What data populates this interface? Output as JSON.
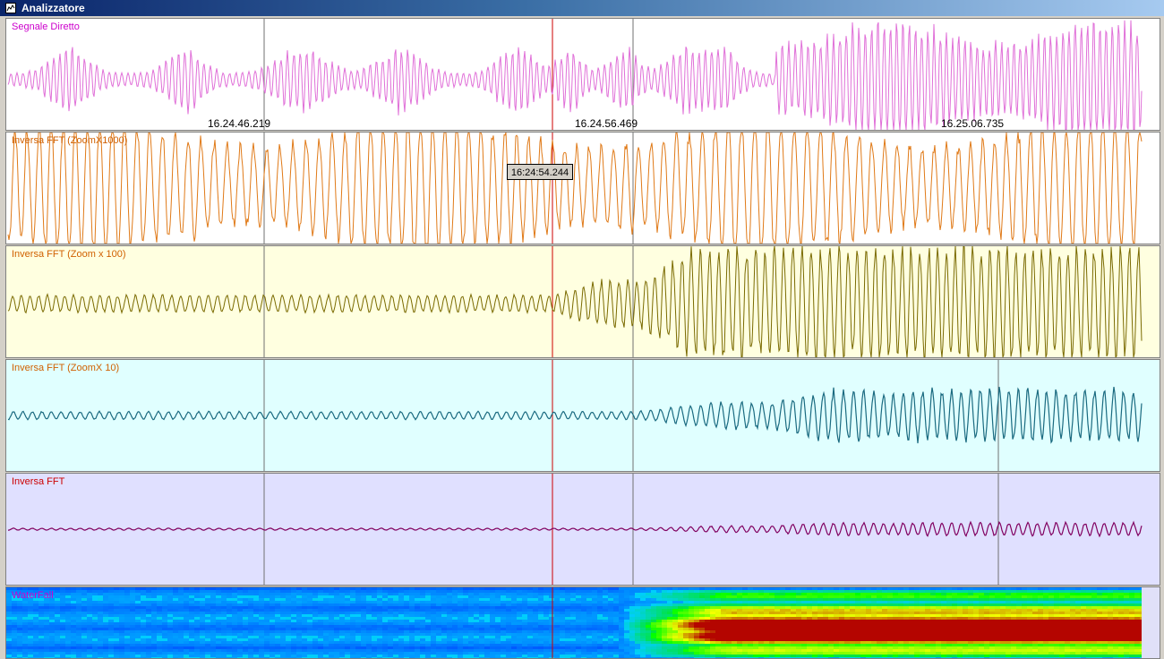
{
  "window": {
    "title": "Analizzatore"
  },
  "colors": {
    "cursor": "#cc0000",
    "gridline": "#707070"
  },
  "panels": [
    {
      "id": "signal",
      "label": "Segnale Diretto",
      "label_color": "#cc00cc",
      "bg": "#ffffff",
      "trace": "#e070d8"
    },
    {
      "id": "fft1000",
      "label": "Inversa FFT (ZoomX1000)",
      "label_color": "#d06000",
      "bg": "#ffffff",
      "trace": "#e07a18"
    },
    {
      "id": "fft100",
      "label": "Inversa FFT (Zoom x 100)",
      "label_color": "#d06000",
      "bg": "#ffffe0",
      "trace": "#7a6a00"
    },
    {
      "id": "fft10",
      "label": "Inversa FFT (ZoomX 10)",
      "label_color": "#d06000",
      "bg": "#e0ffff",
      "trace": "#1a6a80"
    },
    {
      "id": "fft",
      "label": "Inversa FFT",
      "label_color": "#cc0000",
      "bg": "#e0e0ff",
      "trace": "#800060"
    },
    {
      "id": "waterfall",
      "label": "WaterFall",
      "label_color": "#cc00cc",
      "bg": "#0030ff",
      "trace": ""
    }
  ],
  "timestamps": [
    "16.24.46.219",
    "16.24.56.469",
    "16.25.06.735"
  ],
  "cursor_tooltip": "16:24:54.244",
  "icons": {
    "window": "chart-window-icon"
  }
}
